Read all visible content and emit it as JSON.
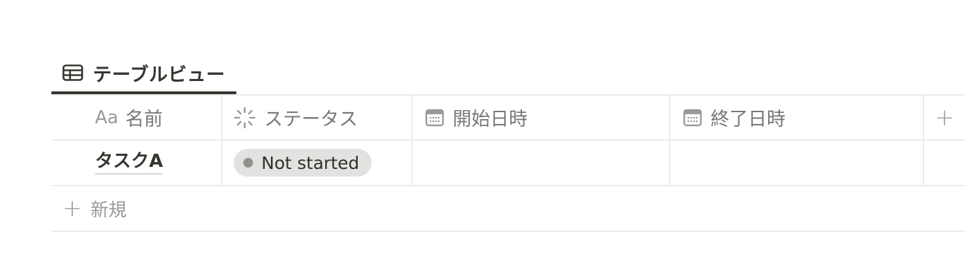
{
  "view_tab": {
    "icon": "table-icon",
    "label": "テーブルビュー"
  },
  "table": {
    "columns": [
      {
        "icon": "title-aa-icon",
        "icon_text": "Aa",
        "label": "名前"
      },
      {
        "icon": "status-spinner-icon",
        "label": "ステータス"
      },
      {
        "icon": "calendar-icon",
        "label": "開始日時"
      },
      {
        "icon": "calendar-icon",
        "label": "終了日時"
      }
    ],
    "add_column_label": "+",
    "rows": [
      {
        "name": "タスクA",
        "status": {
          "label": "Not started",
          "color": "#e3e2e0",
          "dot_color": "#91918e"
        },
        "start": "",
        "end": ""
      }
    ],
    "new_row": {
      "plus": "+",
      "label": "新規"
    }
  },
  "colors": {
    "text": "#37352f",
    "muted": "#9b9a97",
    "border": "#ebebea"
  }
}
